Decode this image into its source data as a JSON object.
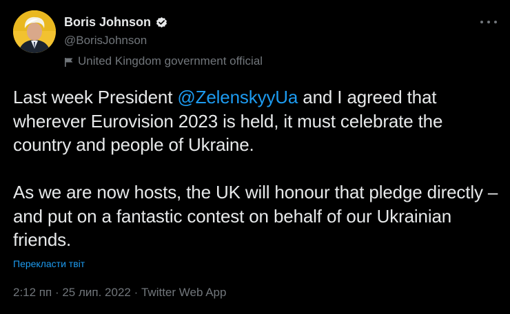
{
  "author": {
    "display_name": "Boris Johnson",
    "handle": "@BorisJohnson",
    "affiliation": "United Kingdom government official",
    "verified": true
  },
  "tweet": {
    "p1_before": "Last week President ",
    "mention": "@ZelenskyyUa",
    "p1_after": " and I agreed that wherever Eurovision 2023 is held, it must celebrate the country and people of Ukraine.",
    "p2": "As we are now hosts, the UK will honour that pledge directly – and put on a fantastic contest on behalf of our Ukrainian friends.",
    "translate_label": "Перекласти твіт",
    "time": "2:12 пп",
    "date": "25 лип. 2022",
    "source": "Twitter Web App",
    "separator": " · "
  },
  "icons": {
    "verified": "verified-badge-icon",
    "affiliation": "flag-icon",
    "more": "more-horizontal-icon"
  },
  "colors": {
    "background": "#000000",
    "primary_text": "#e7e9ea",
    "secondary_text": "#71767b",
    "link": "#1d9bf0",
    "avatar_bg": "#f2c230"
  }
}
